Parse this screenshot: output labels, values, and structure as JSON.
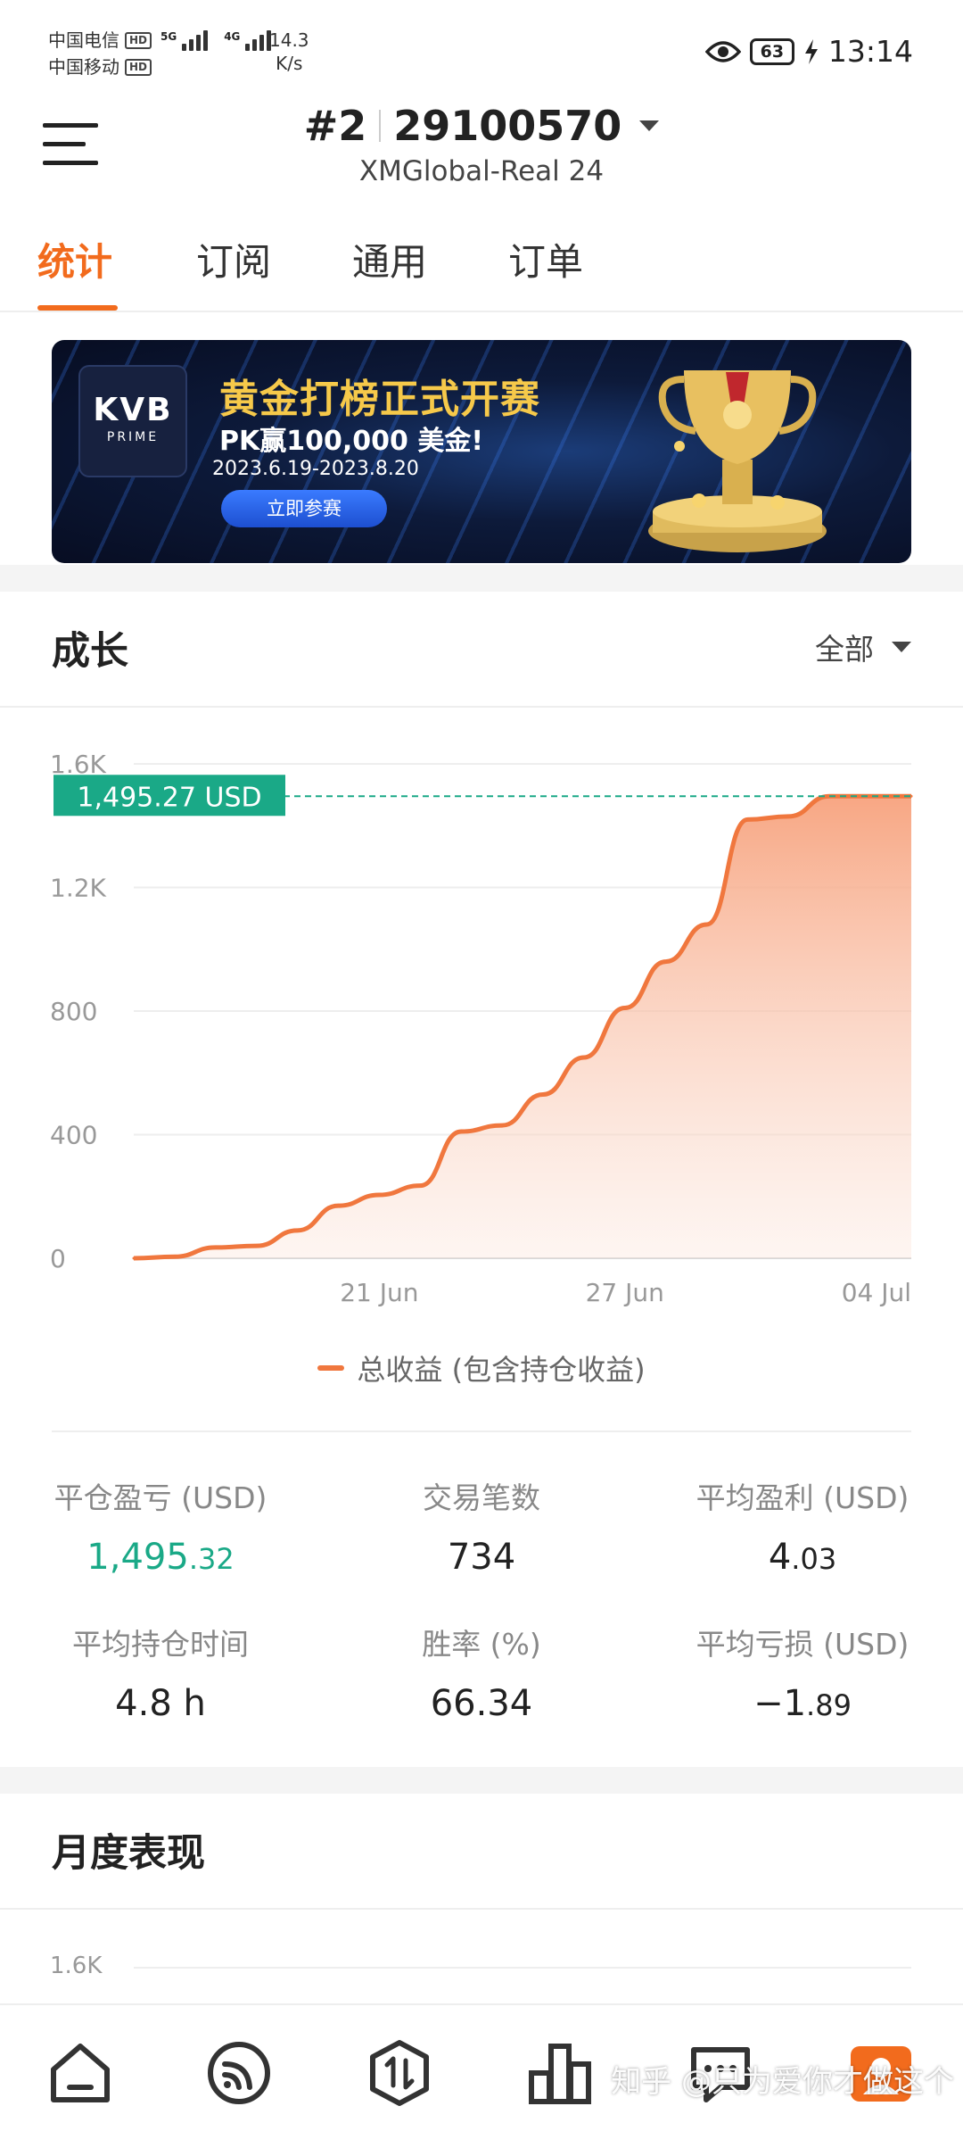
{
  "status_bar": {
    "carrier1": "中国电信",
    "carrier2": "中国移动",
    "hd": "HD",
    "net_gen1": "5G",
    "net_gen2": "4G",
    "speed_value": "14.3",
    "speed_unit": "K/s",
    "battery": "63",
    "time": "13:14"
  },
  "header": {
    "rank": "#2",
    "account_number": "29100570",
    "server": "XMGlobal-Real 24"
  },
  "tabs": [
    {
      "label": "统计",
      "active": true
    },
    {
      "label": "订阅",
      "active": false
    },
    {
      "label": "通用",
      "active": false
    },
    {
      "label": "订单",
      "active": false
    }
  ],
  "banner": {
    "logo_main": "KVB",
    "logo_sub": "PRIME",
    "title": "黄金打榜正式开赛",
    "prize": "PK赢100,000 美金!",
    "dates": "2023.6.19-2023.8.20",
    "cta": "立即参赛"
  },
  "growth": {
    "title": "成长",
    "period": "全部"
  },
  "chart_data": {
    "type": "area",
    "series": [
      {
        "name": "总收益 (包含持仓收益)",
        "color": "#f0773e",
        "x": [
          "2023-06-15",
          "2023-06-16",
          "2023-06-17",
          "2023-06-18",
          "2023-06-19",
          "2023-06-20",
          "2023-06-21",
          "2023-06-22",
          "2023-06-23",
          "2023-06-24",
          "2023-06-25",
          "2023-06-26",
          "2023-06-27",
          "2023-06-28",
          "2023-06-29",
          "2023-06-30",
          "2023-07-01",
          "2023-07-02",
          "2023-07-03",
          "2023-07-04"
        ],
        "values": [
          0,
          5,
          35,
          40,
          90,
          170,
          205,
          235,
          410,
          430,
          530,
          650,
          810,
          960,
          1080,
          1420,
          1430,
          1495.27,
          1495.27,
          1495.27
        ]
      }
    ],
    "y_ticks": [
      "0",
      "400",
      "800",
      "1.2K",
      "1.6K"
    ],
    "x_ticks": [
      "21 Jun",
      "27 Jun",
      "04 Jul"
    ],
    "ylim": [
      0,
      1600
    ],
    "current_value_label": "1,495.27 USD",
    "current_value": 1495.27,
    "grid": true,
    "legend_position": "bottom"
  },
  "legend_label": "总收益 (包含持仓收益)",
  "stats": {
    "closed_pnl_label": "平仓盈亏 (USD)",
    "closed_pnl_int": "1,495",
    "closed_pnl_dec": ".32",
    "trades_label": "交易笔数",
    "trades_value": "734",
    "avg_profit_label": "平均盈利 (USD)",
    "avg_profit_int": "4",
    "avg_profit_dec": ".03",
    "avg_hold_label": "平均持仓时间",
    "avg_hold_value": "4.8 h",
    "win_rate_label": "胜率 (%)",
    "win_rate_value": "66.34",
    "avg_loss_label": "平均亏损 (USD)",
    "avg_loss_int": "−1",
    "avg_loss_dec": ".89"
  },
  "monthly": {
    "title": "月度表现",
    "first_tick": "1.6K"
  },
  "bottom_nav": [
    {
      "icon": "home-icon"
    },
    {
      "icon": "signal-feed-icon"
    },
    {
      "icon": "trade-icon"
    },
    {
      "icon": "chart-icon"
    },
    {
      "icon": "message-icon"
    },
    {
      "icon": "profile-icon"
    }
  ],
  "watermark": "知乎 @只为爱你才做这个"
}
